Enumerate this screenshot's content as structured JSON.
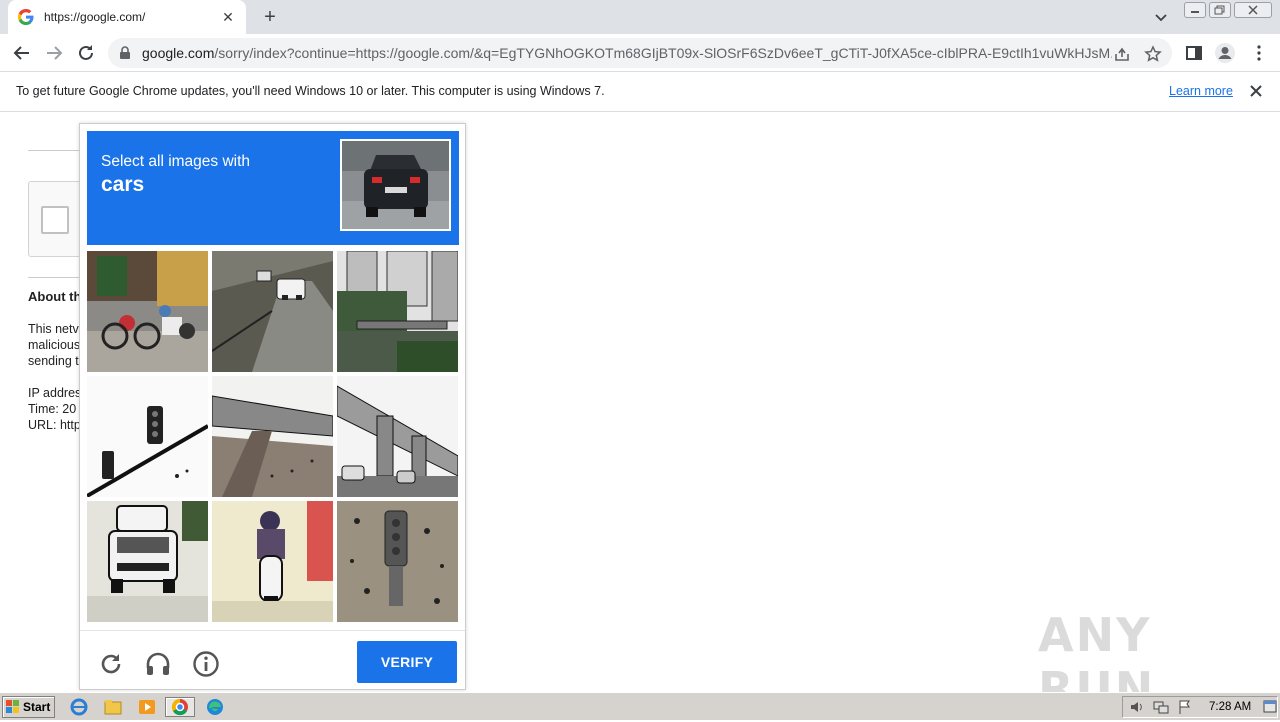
{
  "browser": {
    "tab": {
      "title": "https://google.com/",
      "close": "✕"
    },
    "new_tab": "+",
    "address": {
      "host": "google.com",
      "path": "/sorry/index?continue=https://google.com/&q=EgTYGNhOGKOTm68GIjBT09x-SlOSrF6SzDv6eeT_gCTiT-J0fXA5ce-cIblPRA-E9ctIh1vuWkHJsM..."
    },
    "infobar": {
      "message": "To get future Google Chrome updates, you'll need Windows 10 or later. This computer is using Windows 7.",
      "link": "Learn more"
    }
  },
  "page": {
    "about_heading": "About th",
    "para1": [
      "This netv",
      "malicious",
      "sending t"
    ],
    "para2": [
      "IP addres",
      "Time: 20",
      "URL: http"
    ]
  },
  "captcha": {
    "prompt_line1": "Select all images with",
    "prompt_target": "cars",
    "verify_label": "VERIFY",
    "tiles": [
      "scooter-riders-street",
      "road-with-car",
      "trees-and-buildings",
      "traffic-light",
      "overpass-bridge",
      "elevated-road-with-cars",
      "white-suv",
      "motorcycle-rider",
      "traffic-light-closeup"
    ],
    "accent_color": "#1a73e8"
  },
  "watermark": "ANY RUN",
  "taskbar": {
    "start_label": "Start",
    "clock": "7:28 AM"
  }
}
